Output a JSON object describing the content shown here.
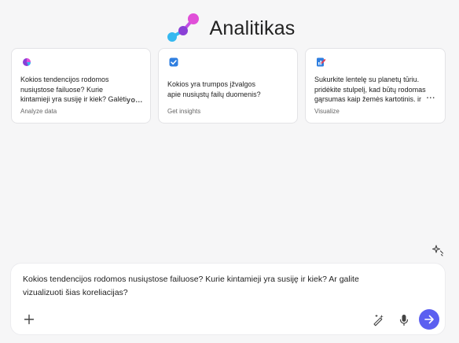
{
  "header": {
    "title": "Analitikas",
    "logo_icon": "molecule-logo-icon",
    "colors": {
      "cyan": "#35b8f0",
      "purple": "#8a3fd6",
      "magenta": "#e04fd8"
    }
  },
  "cards": [
    {
      "icon": "pie-chart-icon",
      "text": "Kokios tendencijos rodomos nusiųstose failuose? Kurie kintamieji yra susiję ir kiek? Galėti",
      "more": "yo...",
      "tag": "Analyze data"
    },
    {
      "icon": "checkbox-icon",
      "text": "Kokios yra trumpos įžvalgos apie nusiųstų failų duomenis?",
      "tag": "Get insights"
    },
    {
      "icon": "document-chart-icon",
      "text": "Sukurkite lentelę su planetų tūriu. pridėkite stulpelį, kad būtų rodomas gąrsumas kaip žemės kartotinis. ir",
      "more": "...",
      "tag": "Visualize"
    }
  ],
  "composer": {
    "text": "Kokios tendencijos rodomos nusiųstose failuose? Kurie kintamieji yra susiję ir kiek? Ar galite vizualizuoti šias koreliacijas?",
    "icons": {
      "add": "plus-icon",
      "sparkle_top": "sparkle-icon",
      "magic": "magic-pen-icon",
      "mic": "microphone-icon",
      "send": "arrow-right-icon"
    },
    "accent": "#5b5ff0"
  }
}
